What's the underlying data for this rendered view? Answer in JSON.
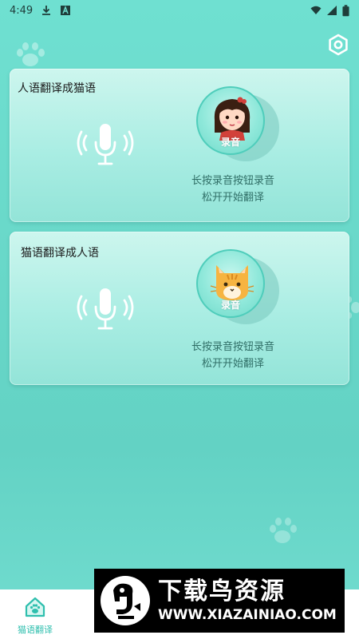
{
  "status_bar": {
    "time": "4:49",
    "icons": [
      "download-icon",
      "font-icon",
      "wifi-icon",
      "signal-icon",
      "battery-icon"
    ]
  },
  "header": {
    "settings_icon": "gear-icon"
  },
  "cards": [
    {
      "title": "人语翻译成猫语",
      "mic_icon": "microphone-icon",
      "record_label": "录音",
      "avatar": "girl-avatar",
      "hint_line1": "长按录音按钮录音",
      "hint_line2": "松开开始翻译"
    },
    {
      "title": "猫语翻译成人语",
      "mic_icon": "microphone-icon",
      "record_label": "录音",
      "avatar": "cat-avatar",
      "hint_line1": "长按录音按钮录音",
      "hint_line2": "松开开始翻译"
    }
  ],
  "bottom_nav": {
    "items": [
      {
        "label": "猫语翻译",
        "icon": "home-icon",
        "active": true
      }
    ]
  },
  "watermark": {
    "title": "下载鸟资源",
    "url": "WWW.XIAZAINIAO.COM"
  },
  "colors": {
    "background": "#6ad9ca",
    "accent": "#2fbfae",
    "card": "#a9ede3",
    "hint_text": "#2f6e66"
  }
}
